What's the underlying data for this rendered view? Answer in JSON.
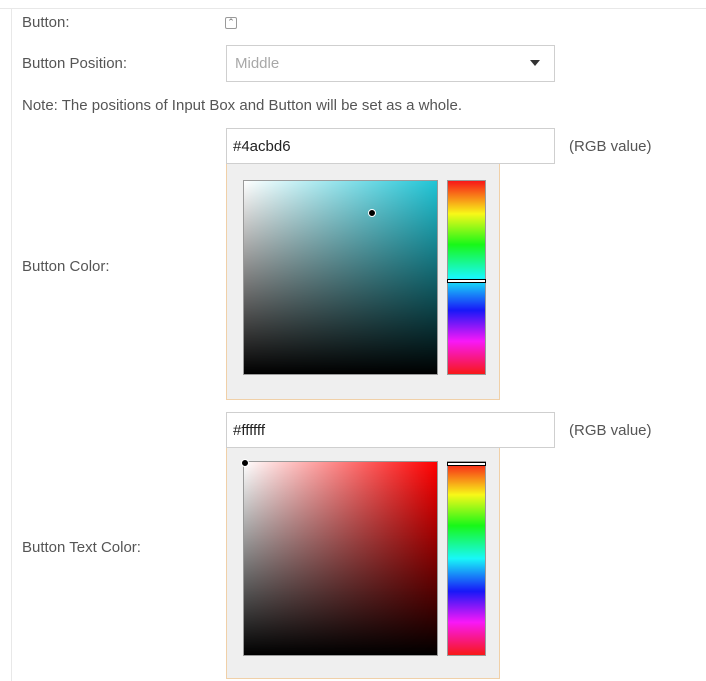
{
  "form": {
    "button_label": "Button:",
    "button_toggle_icon": "collapse-up-icon",
    "button_position_label": "Button Position:",
    "button_position_value": "Middle",
    "note": "Note: The positions of Input Box and Button will be set as a whole.",
    "button_color_label": "Button Color:",
    "button_color_value": "#4acbd6",
    "button_color_hint": "(RGB value)",
    "button_text_color_label": "Button Text Color:",
    "button_text_color_value": "#ffffff",
    "button_text_color_hint": "(RGB value)"
  },
  "pickers": {
    "button_color": {
      "hue_color": "#20c5d6",
      "saturation": 0.66,
      "brightness": 0.84,
      "hue_position": 0.51
    },
    "button_text_color": {
      "hue_color": "#ff0000",
      "saturation": 0.0,
      "brightness": 1.0,
      "hue_position": 0.0
    }
  },
  "colors": {
    "panel_border": "#f0d0a8",
    "input_border": "#cfcfcf",
    "label_text": "#555555",
    "placeholder_text": "#a8a8a8"
  }
}
